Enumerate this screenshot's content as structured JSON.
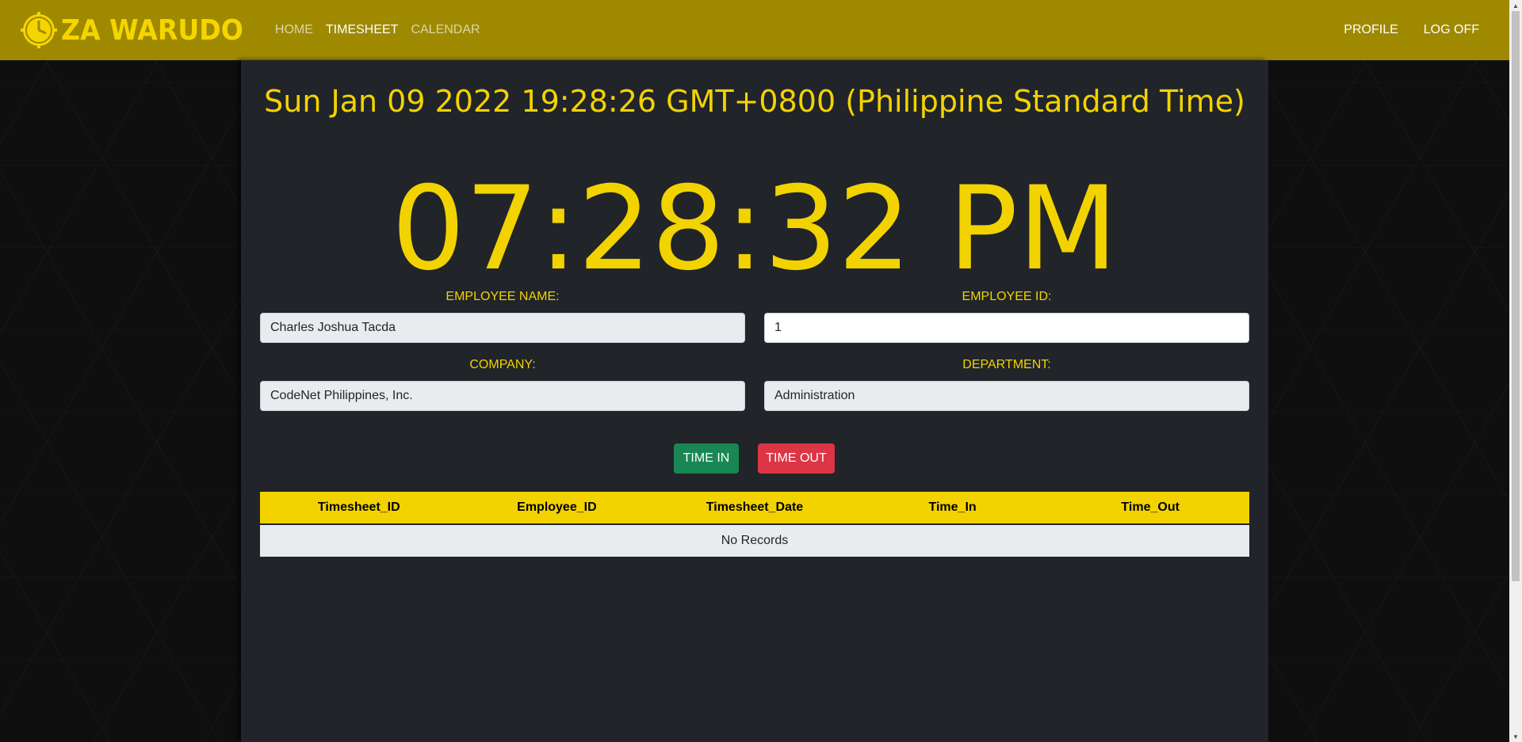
{
  "nav": {
    "brand": "ZA WARUDO",
    "links": [
      "HOME",
      "TIMESHEET",
      "CALENDAR"
    ],
    "right": [
      "PROFILE",
      "LOG OFF"
    ]
  },
  "datetime": {
    "full": "Sun Jan 09 2022 19:28:26 GMT+0800 (Philippine Standard Time)",
    "clock": "07:28:32 PM"
  },
  "form": {
    "employee_name": {
      "label": "EMPLOYEE NAME:",
      "value": "Charles Joshua Tacda"
    },
    "employee_id": {
      "label": "EMPLOYEE ID:",
      "value": "1"
    },
    "company": {
      "label": "COMPANY:",
      "value": "CodeNet Philippines, Inc."
    },
    "department": {
      "label": "DEPARTMENT:",
      "value": "Administration"
    }
  },
  "buttons": {
    "time_in": "TIME IN",
    "time_out": "TIME OUT"
  },
  "table": {
    "columns": [
      "Timesheet_ID",
      "Employee_ID",
      "Timesheet_Date",
      "Time_In",
      "Time_Out"
    ],
    "empty": "No Records"
  },
  "colors": {
    "navbar": "#9e8900",
    "accent": "#f2d300",
    "panel": "#212429",
    "time_in": "#198754",
    "time_out": "#dc3545"
  },
  "icons": {
    "brand": "clock-icon"
  }
}
